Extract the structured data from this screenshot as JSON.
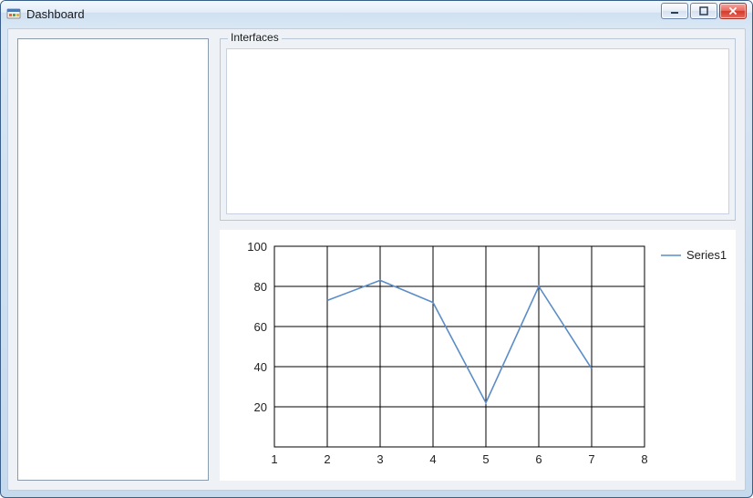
{
  "window": {
    "title": "Dashboard"
  },
  "groupbox": {
    "title": "Interfaces"
  },
  "chart_data": {
    "type": "line",
    "x": [
      1,
      2,
      3,
      4,
      5,
      6,
      7,
      8
    ],
    "series": [
      {
        "name": "Series1",
        "values": [
          null,
          73,
          83,
          72,
          22,
          80,
          39,
          null
        ]
      }
    ],
    "xlim": [
      1,
      8
    ],
    "ylim": [
      0,
      100
    ],
    "xticks": [
      1,
      2,
      3,
      4,
      5,
      6,
      7,
      8
    ],
    "yticks": [
      20,
      40,
      60,
      80,
      100
    ],
    "grid": true,
    "legend_position": "right"
  }
}
